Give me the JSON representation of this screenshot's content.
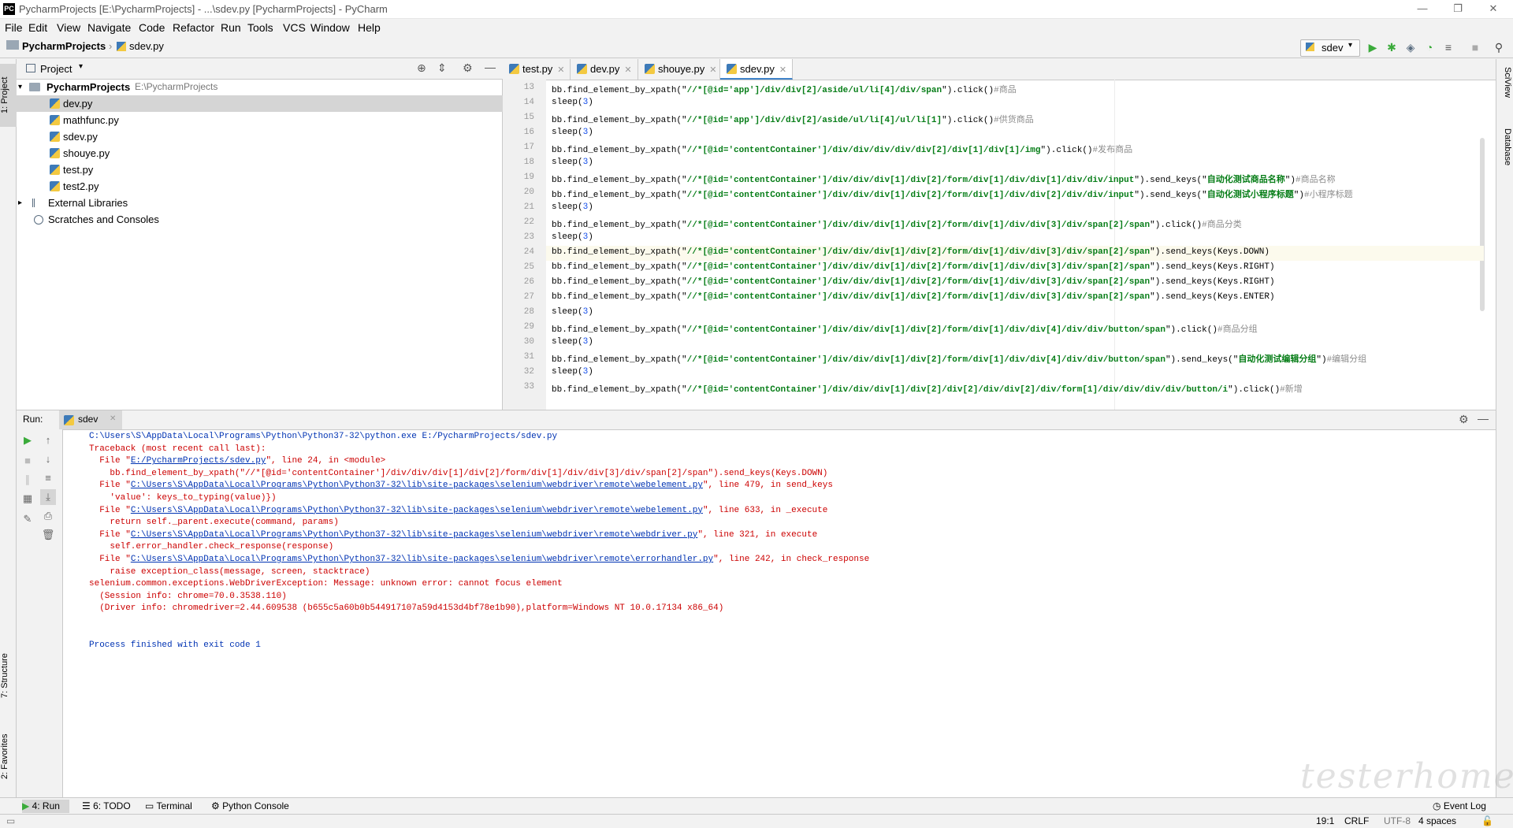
{
  "window": {
    "title": "PycharmProjects [E:\\PycharmProjects] - ...\\sdev.py [PycharmProjects] - PyCharm",
    "logo": "PC"
  },
  "menu": [
    "File",
    "Edit",
    "View",
    "Navigate",
    "Code",
    "Refactor",
    "Run",
    "Tools",
    "VCS",
    "Window",
    "Help"
  ],
  "breadcrumb": {
    "project": "PycharmProjects",
    "file": "sdev.py"
  },
  "run_config": "sdev",
  "project_panel": {
    "title": "Project",
    "root": {
      "name": "PycharmProjects",
      "path": "E:\\PycharmProjects"
    },
    "files": [
      "dev.py",
      "mathfunc.py",
      "sdev.py",
      "shouye.py",
      "test.py",
      "test2.py"
    ],
    "extras": [
      "External Libraries",
      "Scratches and Consoles"
    ]
  },
  "left_tools": [
    "1: Project",
    "7: Structure",
    "2: Favorites"
  ],
  "right_tools": [
    "SciView",
    "Database"
  ],
  "editor_tabs": [
    "test.py",
    "dev.py",
    "shouye.py",
    "sdev.py"
  ],
  "code_lines": [
    {
      "n": "13",
      "a": "bb.find_element_by_xpath(\"",
      "s": "//*[@id='app']/div/div[2]/aside/ul/li[4]/div/span",
      "b": "\").click()",
      "c": "#商品"
    },
    {
      "n": "14",
      "a": "sleep(",
      "num": "3",
      "b": ")"
    },
    {
      "n": "15",
      "a": "bb.find_element_by_xpath(\"",
      "s": "//*[@id='app']/div/div[2]/aside/ul/li[4]/ul/li[1]",
      "b": "\").click()",
      "c": "#供货商品"
    },
    {
      "n": "16",
      "a": "sleep(",
      "num": "3",
      "b": ")"
    },
    {
      "n": "17",
      "a": "bb.find_element_by_xpath(\"",
      "s": "//*[@id='contentContainer']/div/div/div/div/div[2]/div[1]/div[1]/img",
      "b": "\").click()",
      "c": "#发布商品"
    },
    {
      "n": "18",
      "a": "sleep(",
      "num": "3",
      "b": ")"
    },
    {
      "n": "19",
      "a": "bb.find_element_by_xpath(\"",
      "s": "//*[@id='contentContainer']/div/div/div[1]/div[2]/form/div[1]/div/div[1]/div/div/input",
      "b": "\").send_keys(\"",
      "s2": "自动化测试商品名称",
      "b2": "\")",
      "c": "#商品名称"
    },
    {
      "n": "20",
      "a": "bb.find_element_by_xpath(\"",
      "s": "//*[@id='contentContainer']/div/div/div[1]/div[2]/form/div[1]/div/div[2]/div/div/input",
      "b": "\").send_keys(\"",
      "s2": "自动化测试小程序标题",
      "b2": "\")",
      "c": "#小程序标题"
    },
    {
      "n": "21",
      "a": "sleep(",
      "num": "3",
      "b": ")"
    },
    {
      "n": "22",
      "a": "bb.find_element_by_xpath(\"",
      "s": "//*[@id='contentContainer']/div/div/div[1]/div[2]/form/div[1]/div/div[3]/div/span[2]/span",
      "b": "\").click()",
      "c": "#商品分类"
    },
    {
      "n": "23",
      "a": "sleep(",
      "num": "3",
      "b": ")"
    },
    {
      "n": "24",
      "a": "bb.find_element_by_xpath(\"",
      "s": "//*[@id='contentContainer']/div/div/div[1]/div[2]/form/div[1]/div/div[3]/div/span[2]/span",
      "b": "\").send_keys(Keys.DOWN)"
    },
    {
      "n": "25",
      "a": "bb.find_element_by_xpath(\"",
      "s": "//*[@id='contentContainer']/div/div/div[1]/div[2]/form/div[1]/div/div[3]/div/span[2]/span",
      "b": "\").send_keys(Keys.RIGHT)"
    },
    {
      "n": "26",
      "a": "bb.find_element_by_xpath(\"",
      "s": "//*[@id='contentContainer']/div/div/div[1]/div[2]/form/div[1]/div/div[3]/div/span[2]/span",
      "b": "\").send_keys(Keys.RIGHT)"
    },
    {
      "n": "27",
      "a": "bb.find_element_by_xpath(\"",
      "s": "//*[@id='contentContainer']/div/div/div[1]/div[2]/form/div[1]/div/div[3]/div/span[2]/span",
      "b": "\").send_keys(Keys.ENTER)"
    },
    {
      "n": "28",
      "a": "sleep(",
      "num": "3",
      "b": ")"
    },
    {
      "n": "29",
      "a": "bb.find_element_by_xpath(\"",
      "s": "//*[@id='contentContainer']/div/div/div[1]/div[2]/form/div[1]/div/div[4]/div/div/button/span",
      "b": "\").click()",
      "c": "#商品分组"
    },
    {
      "n": "30",
      "a": "sleep(",
      "num": "3",
      "b": ")"
    },
    {
      "n": "31",
      "a": "bb.find_element_by_xpath(\"",
      "s": "//*[@id='contentContainer']/div/div/div[1]/div[2]/form/div[1]/div/div[4]/div/div/button/span",
      "b": "\").send_keys(\"",
      "s2": "自动化测试编辑分组",
      "b2": "\")",
      "c": "#编辑分组"
    },
    {
      "n": "32",
      "a": "sleep(",
      "num": "3",
      "b": ")"
    },
    {
      "n": "33",
      "a": "bb.find_element_by_xpath(\"",
      "s": "//*[@id='contentContainer']/div/div/div[1]/div[2]/div[2]/div/div[2]/div/form[1]/div/div/div/div/button/i",
      "b": "\").click()",
      "c": "#新增"
    }
  ],
  "run_panel": {
    "label": "Run:",
    "tab": "sdev",
    "console": [
      {
        "t": "C:\\Users\\S\\AppData\\Local\\Programs\\Python\\Python37-32\\python.exe E:/PycharmProjects/sdev.py",
        "cls": "path"
      },
      {
        "t": "Traceback (most recent call last):"
      },
      {
        "t": "  File \"",
        "link": "E:/PycharmProjects/sdev.py",
        "t2": "\", line 24, in <module>"
      },
      {
        "t": "    bb.find_element_by_xpath(\"//*[@id='contentContainer']/div/div/div[1]/div[2]/form/div[1]/div/div[3]/div/span[2]/span\").send_keys(Keys.DOWN)"
      },
      {
        "t": "  File \"",
        "link": "C:\\Users\\S\\AppData\\Local\\Programs\\Python\\Python37-32\\lib\\site-packages\\selenium\\webdriver\\remote\\webelement.py",
        "t2": "\", line 479, in send_keys"
      },
      {
        "t": "    'value': keys_to_typing(value)})"
      },
      {
        "t": "  File \"",
        "link": "C:\\Users\\S\\AppData\\Local\\Programs\\Python\\Python37-32\\lib\\site-packages\\selenium\\webdriver\\remote\\webelement.py",
        "t2": "\", line 633, in _execute"
      },
      {
        "t": "    return self._parent.execute(command, params)"
      },
      {
        "t": "  File \"",
        "link": "C:\\Users\\S\\AppData\\Local\\Programs\\Python\\Python37-32\\lib\\site-packages\\selenium\\webdriver\\remote\\webdriver.py",
        "t2": "\", line 321, in execute"
      },
      {
        "t": "    self.error_handler.check_response(response)"
      },
      {
        "t": "  File \"",
        "link": "C:\\Users\\S\\AppData\\Local\\Programs\\Python\\Python37-32\\lib\\site-packages\\selenium\\webdriver\\remote\\errorhandler.py",
        "t2": "\", line 242, in check_response"
      },
      {
        "t": "    raise exception_class(message, screen, stacktrace)"
      },
      {
        "t": "selenium.common.exceptions.WebDriverException: Message: unknown error: cannot focus element"
      },
      {
        "t": "  (Session info: chrome=70.0.3538.110)"
      },
      {
        "t": "  (Driver info: chromedriver=2.44.609538 (b655c5a60b0b544917107a59d4153d4bf78e1b90),platform=Windows NT 10.0.17134 x86_64)"
      },
      {
        "t": ""
      },
      {
        "t": ""
      },
      {
        "t": "Process finished with exit code 1",
        "cls": "path"
      }
    ]
  },
  "bottom_tabs": [
    "4: Run",
    "6: TODO",
    "Terminal",
    "Python Console"
  ],
  "event_log": "Event Log",
  "status": {
    "position": "19:1",
    "line_sep": "CRLF",
    "encoding": "UTF-8",
    "indent": "4 spaces"
  },
  "watermark": "testerhome.com"
}
